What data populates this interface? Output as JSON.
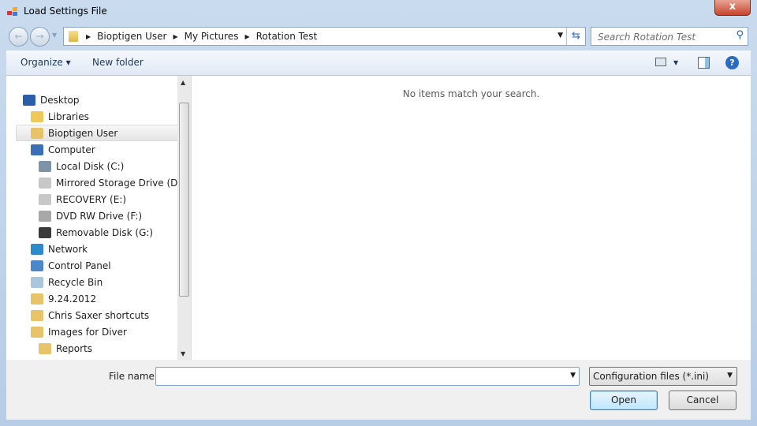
{
  "window": {
    "title": "Load Settings File",
    "close_label": "x"
  },
  "address": {
    "crumbs": [
      "Bioptigen User",
      "My Pictures",
      "Rotation Test"
    ]
  },
  "search": {
    "placeholder": "Search Rotation Test"
  },
  "toolbar": {
    "organize": "Organize ▾",
    "new_folder": "New folder"
  },
  "nav": {
    "items": [
      {
        "label": "Desktop",
        "icon": "desktop-icon",
        "color": "#2a5ea8"
      },
      {
        "label": "Libraries",
        "icon": "libraries-icon",
        "color": "#f0c85a"
      },
      {
        "label": "Bioptigen User",
        "icon": "user-folder-icon",
        "color": "#e9c36a",
        "selected": true
      },
      {
        "label": "Computer",
        "icon": "computer-icon",
        "color": "#3b6fb5"
      },
      {
        "label": "Local Disk (C:)",
        "icon": "system-drive-icon",
        "color": "#7e93a8"
      },
      {
        "label": "Mirrored Storage Drive (D:)",
        "icon": "drive-icon",
        "color": "#c8c8c8"
      },
      {
        "label": "RECOVERY (E:)",
        "icon": "drive-icon",
        "color": "#c8c8c8"
      },
      {
        "label": "DVD RW Drive (F:)",
        "icon": "dvd-drive-icon",
        "color": "#a8a8a8"
      },
      {
        "label": "Removable Disk (G:)",
        "icon": "removable-disk-icon",
        "color": "#3a3a3a"
      },
      {
        "label": "Network",
        "icon": "network-icon",
        "color": "#2f8ac9"
      },
      {
        "label": "Control Panel",
        "icon": "control-panel-icon",
        "color": "#4a88c8"
      },
      {
        "label": "Recycle Bin",
        "icon": "recycle-bin-icon",
        "color": "#a9c6dc"
      },
      {
        "label": "9.24.2012",
        "icon": "folder-icon",
        "color": "#e9c36a"
      },
      {
        "label": "Chris Saxer shortcuts",
        "icon": "folder-icon",
        "color": "#e9c36a"
      },
      {
        "label": "Images for Diver",
        "icon": "folder-icon",
        "color": "#e9c36a"
      },
      {
        "label": "Reports",
        "icon": "folder-icon",
        "color": "#e9c36a"
      }
    ]
  },
  "main": {
    "empty_message": "No items match your search."
  },
  "footer": {
    "file_name_label": "File name:",
    "file_name_value": "",
    "filter": "Configuration files (*.ini)",
    "open": "Open",
    "cancel": "Cancel"
  }
}
